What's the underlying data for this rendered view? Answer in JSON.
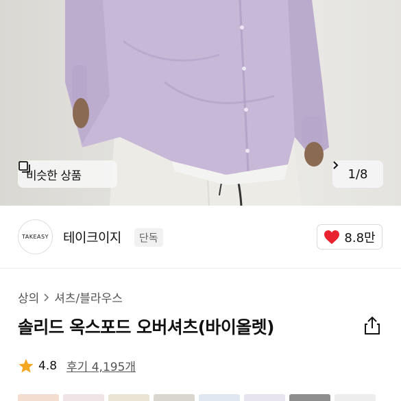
{
  "hero": {
    "similar_label": "비슷한 상품",
    "pager_text": "1/8",
    "shirt_color": "#c7b8d8"
  },
  "brand": {
    "logo_text": "TAKEASY",
    "name": "테이크이지",
    "badge": "단독",
    "like_count": "8.8만",
    "like_color": "#e8232f"
  },
  "breadcrumb": {
    "level1": "상의",
    "level2": "셔츠/블라우스"
  },
  "product": {
    "title": "솔리드 옥스포드 오버셔츠(바이올렛)"
  },
  "rating": {
    "score": "4.8",
    "reviews_label": "후기 4,195개",
    "star_color": "#f5a623"
  },
  "thumbnails": [
    "#f2ddd0",
    "#efe3e6",
    "#e9e4d4",
    "#d8d6cd",
    "#dfe7f1",
    "#e7e4f0",
    "#8e8e8e",
    "#ededed"
  ]
}
